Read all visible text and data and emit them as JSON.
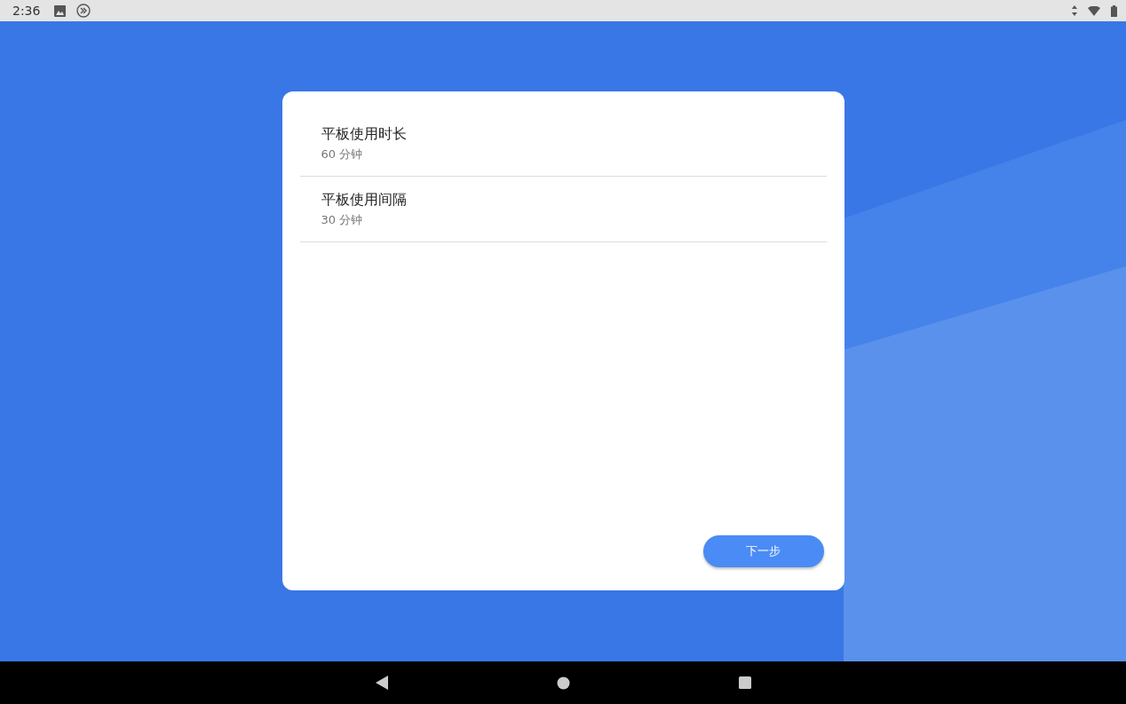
{
  "status_bar": {
    "time": "2:36"
  },
  "settings": [
    {
      "title": "平板使用时长",
      "value": "60 分钟"
    },
    {
      "title": "平板使用间隔",
      "value": "30 分钟"
    }
  ],
  "next_button": {
    "label": "下一步"
  }
}
